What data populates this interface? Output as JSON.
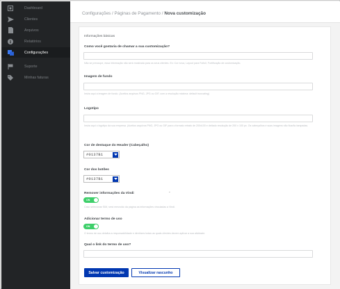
{
  "sidebar": {
    "items": [
      {
        "label": "Dashboard",
        "icon": "dashboard-icon"
      },
      {
        "label": "Clientes",
        "icon": "send-icon"
      },
      {
        "label": "Arquivos",
        "icon": "file-icon"
      },
      {
        "label": "Relatórios",
        "icon": "info-icon"
      },
      {
        "label": "Configurações",
        "icon": "settings-icon"
      },
      {
        "label": "Suporte",
        "icon": "flag-icon"
      },
      {
        "label": "Minhas faturas",
        "icon": "tag-icon"
      }
    ]
  },
  "breadcrumb": {
    "part1": "Configurações",
    "sep1": " / ",
    "part2": "Páginas de Pagamento",
    "sep2": " / ",
    "current": "Nova customização"
  },
  "form": {
    "section_title": "Informações básicas",
    "name_label": "Como você gostaria de chamar a sua customização?",
    "name_value": "",
    "name_help": "Não se preocupe, essa informação não será mostrada para os seus clientes. Ex: Cor nova, Layout para Fulfull, Fortificação de customização.",
    "bg_label": "Imagem de fundo",
    "bg_help": "Insira aqui a imagem de fundo. (Aceitos arquivos PNG, JPG ou GIF, com a resolução máxima: default truncating)",
    "logo_label": "Logotipo",
    "logo_help": "Insira aqui o logotipo da sua empresa. (Aceitos arquivos PNG, JPG ou GIF para o formato retrato de 200x100 e deitado resolução de 200 x 100 px. Os cabeçalhos e suas imagens não ficarão tampadas.",
    "header_color_label": "Cor de destaque do Header (Cabeçalho)",
    "header_color_value": "#0137B1",
    "button_color_label": "Cor dos botões",
    "button_color_value": "#0137B1",
    "remove_label": "Remover informações da Vindi",
    "remove_toggle": "ON",
    "remove_help": "Caso selecionar SIM, será removido da página as informações vinculadas a Vindi.",
    "terms_label": "Adicionar termo de uso",
    "terms_toggle": "ON",
    "terms_help": "O termo de uso detalha a responsabilidade e diretrizes todas as quais clientes devem aplicar a sua atividade.",
    "terms_link_label": "Qual o link do termo de uso?",
    "terms_link_value": "",
    "save_button": "Salvar customização",
    "preview_button": "Visualizar rascunho"
  },
  "colors": {
    "sidebar_bg": "#222426",
    "accent": "#0137b1",
    "toggle_on": "#3ecf6a"
  }
}
